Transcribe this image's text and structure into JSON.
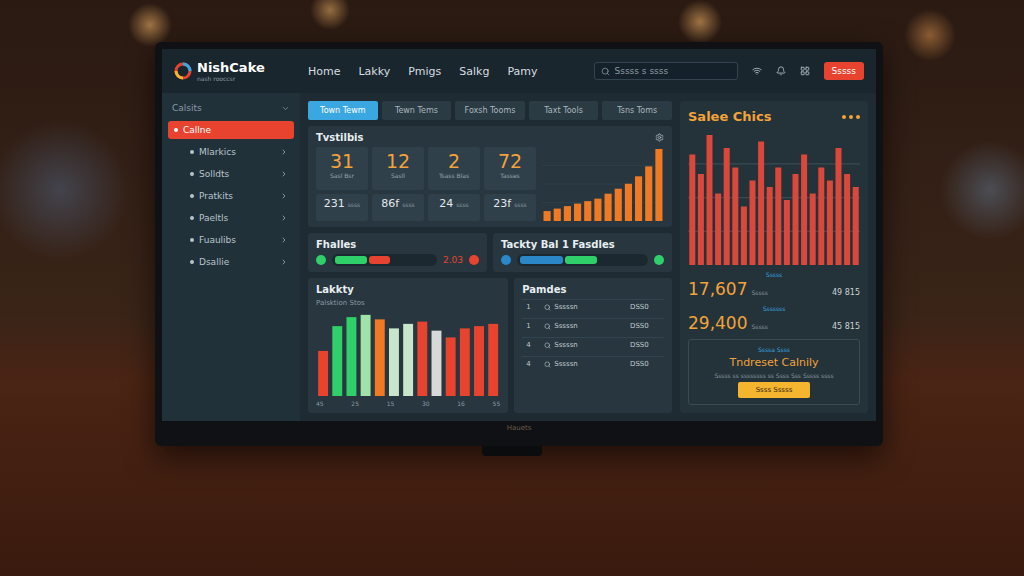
{
  "brand": {
    "name": "NishCake",
    "tagline": "nash rooccsr"
  },
  "nav": [
    {
      "label": "Home"
    },
    {
      "label": "Lakky"
    },
    {
      "label": "Pmigs"
    },
    {
      "label": "Salkg"
    },
    {
      "label": "Pamy"
    }
  ],
  "search": {
    "placeholder": "Sssss s ssss"
  },
  "header_button": "Sssss",
  "monitor_brand": "Hauets",
  "sidebar": {
    "title": "Calsits",
    "items": [
      {
        "label": "Callne",
        "selected": true
      },
      {
        "label": "Mlarkics",
        "selected": false
      },
      {
        "label": "Solldts",
        "selected": false
      },
      {
        "label": "Pratkits",
        "selected": false
      },
      {
        "label": "Paeltls",
        "selected": false
      },
      {
        "label": "Fuaulibs",
        "selected": false
      },
      {
        "label": "Dsallie",
        "selected": false
      }
    ]
  },
  "tabs": [
    {
      "label": "Town Tewm",
      "selected": true
    },
    {
      "label": "Tewn Tems",
      "selected": false
    },
    {
      "label": "Foxsh Tooms",
      "selected": false
    },
    {
      "label": "Taxt Tools",
      "selected": false
    },
    {
      "label": "Tsns Toms",
      "selected": false
    }
  ],
  "stats_card": {
    "title": "Tvstilbis",
    "stats": [
      {
        "value": "31",
        "label": "Sasl Bsr",
        "sub": "231",
        "unit": "ssss"
      },
      {
        "value": "12",
        "label": "Sasll",
        "sub": "86f",
        "unit": "ssss"
      },
      {
        "value": "2",
        "label": "Tsass Blas",
        "sub": "24",
        "unit": "ssss"
      },
      {
        "value": "72",
        "label": "Tasses",
        "sub": "23f",
        "unit": "ssss"
      }
    ],
    "chart": [
      8,
      10,
      12,
      14,
      16,
      18,
      22,
      26,
      30,
      36,
      44,
      58
    ]
  },
  "sales": {
    "title": "Salee Chics",
    "chart": [
      34,
      28,
      40,
      22,
      36,
      30,
      18,
      26,
      38,
      24,
      30,
      20,
      28,
      34,
      22,
      30,
      26,
      36,
      28,
      24
    ],
    "figures": [
      {
        "label": "Sssss",
        "value": "17,607",
        "unit": "Sssss",
        "side": "49 815"
      },
      {
        "label": "Sssssss",
        "value": "29,400",
        "unit": "Sssss",
        "side": "45 815"
      }
    ]
  },
  "promo": {
    "label": "Ssssa Ssss",
    "title": "Tndreset Calnily",
    "text": "Sssss ss ssssssss ss Ssss Sss Sssss ssss",
    "button": "Ssss Sssss"
  },
  "meters": [
    {
      "title": "Fhalles",
      "segments": [
        {
          "level": 0.32,
          "color": "#2fd06a"
        },
        {
          "level": 0.22,
          "color": "#e8432e"
        }
      ],
      "reading": "2.03"
    },
    {
      "title": "Tackty Bal 1 Fasdles",
      "segments": [
        {
          "level": 0.34,
          "color": "#2b87c8"
        },
        {
          "level": 0.26,
          "color": "#2fd06a"
        }
      ]
    }
  ],
  "activity": {
    "title": "Lakkty",
    "subtitle": "Palsktion Stos",
    "bars": [
      {
        "value": 40,
        "color": "#e8432e"
      },
      {
        "value": 62,
        "color": "#2fd06a"
      },
      {
        "value": 70,
        "color": "#2fd06a"
      },
      {
        "value": 72,
        "color": "#9fe3a8"
      },
      {
        "value": 68,
        "color": "#f07a24"
      },
      {
        "value": 60,
        "color": "#c8e6c9"
      },
      {
        "value": 64,
        "color": "#c8e6c9"
      },
      {
        "value": 66,
        "color": "#e8432e"
      },
      {
        "value": 58,
        "color": "#d8d8d8"
      },
      {
        "value": 52,
        "color": "#e8432e"
      },
      {
        "value": 60,
        "color": "#e8432e"
      },
      {
        "value": 62,
        "color": "#e8432e"
      },
      {
        "value": 64,
        "color": "#e8432e"
      }
    ],
    "ticks": [
      "45",
      "25",
      "15",
      "30",
      "16",
      "55"
    ]
  },
  "table": {
    "title": "Pamdes",
    "rows": [
      {
        "index": "1",
        "name": "Sssssn",
        "value": "DSS0"
      },
      {
        "index": "1",
        "name": "Sssssn",
        "value": "DSS0"
      },
      {
        "index": "4",
        "name": "Sssssn",
        "value": "DSS0"
      },
      {
        "index": "4",
        "name": "Sssssn",
        "value": "DSS0"
      }
    ]
  }
}
